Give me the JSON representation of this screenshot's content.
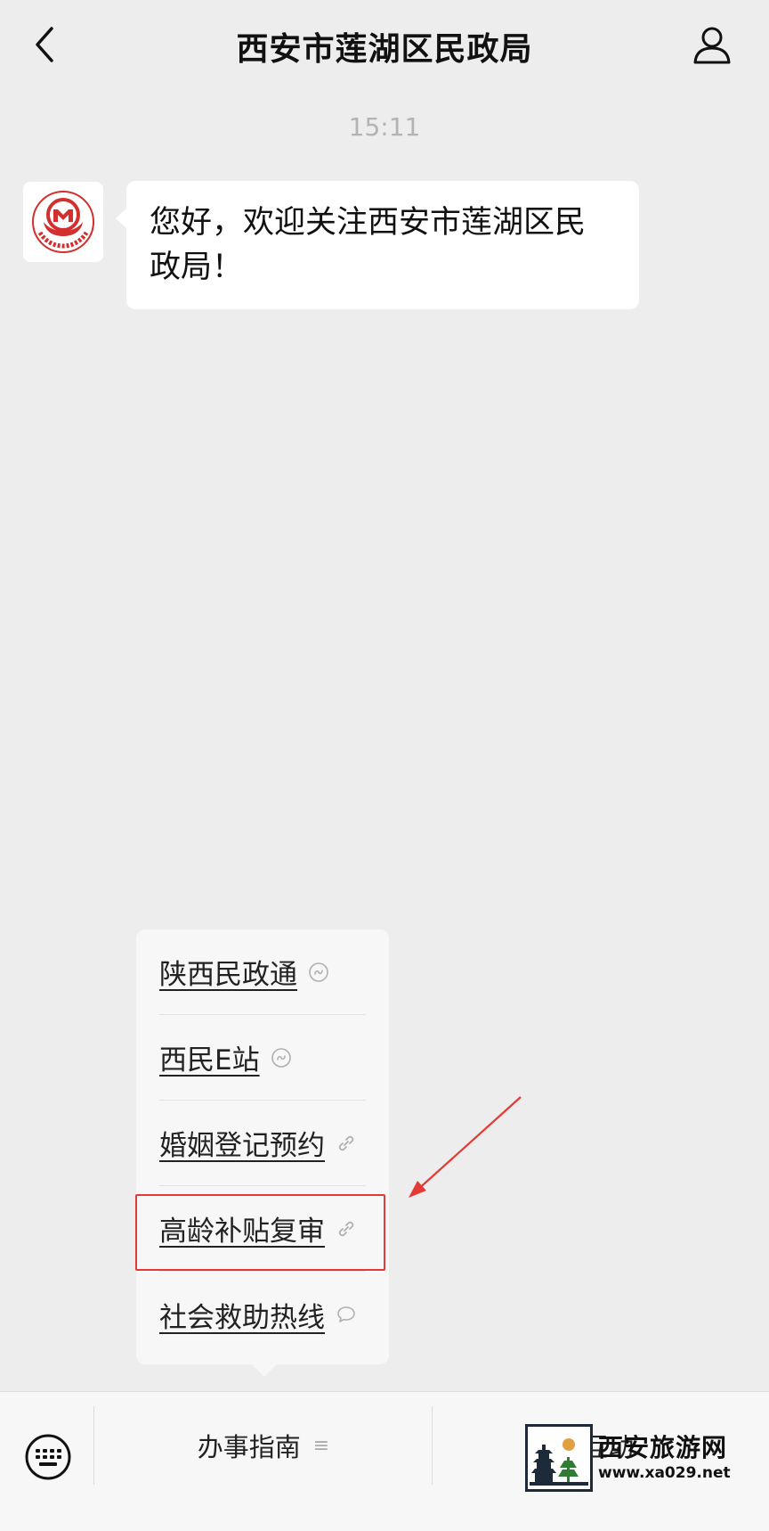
{
  "header": {
    "title": "西安市莲湖区民政局"
  },
  "chat": {
    "time": "15:11",
    "message": "您好，欢迎关注西安市莲湖区民政局！"
  },
  "menu": {
    "items": [
      {
        "label": "陕西民政通",
        "icon": "mini-program-icon"
      },
      {
        "label": "西民E站",
        "icon": "mini-program-icon"
      },
      {
        "label": "婚姻登记预约",
        "icon": "link-icon"
      },
      {
        "label": "高龄补贴复审",
        "icon": "link-icon"
      },
      {
        "label": "社会救助热线",
        "icon": "chat-bubble-icon"
      }
    ]
  },
  "bottom": {
    "tab1": "办事指南",
    "tab2": "政民互动"
  },
  "watermark": {
    "title": "西安旅游网",
    "url": "www.xa029.net"
  },
  "colors": {
    "background": "#ededed",
    "highlight": "#e53935",
    "bubble": "#ffffff"
  }
}
